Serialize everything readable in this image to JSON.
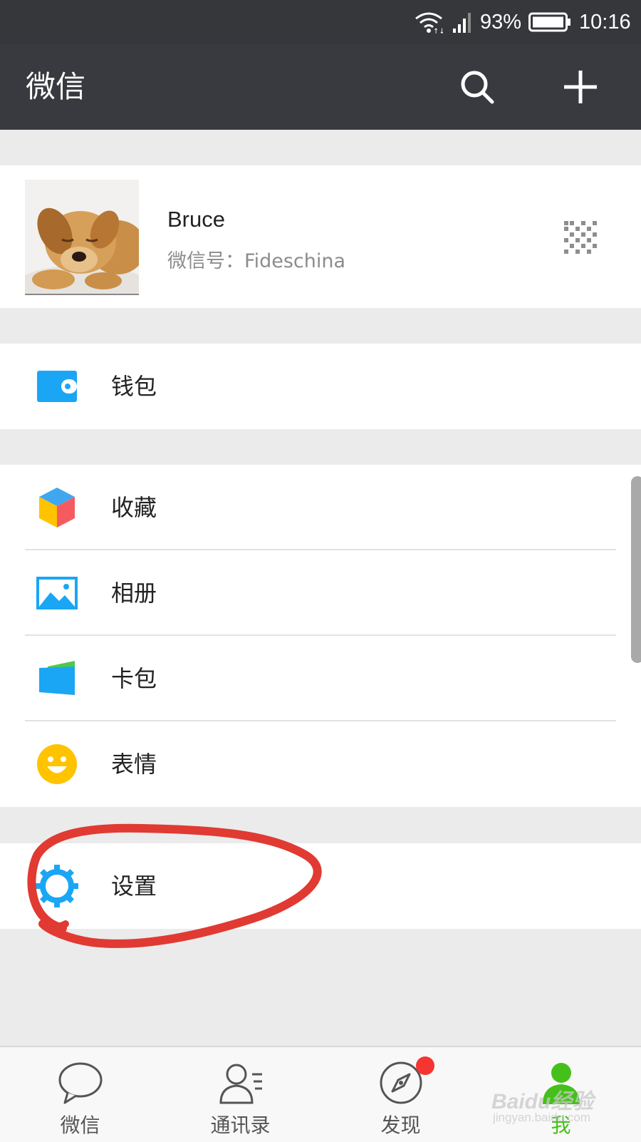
{
  "status_bar": {
    "battery_percent": "93%",
    "time": "10:16",
    "icons": [
      "wifi-icon",
      "signal-icon",
      "battery-icon"
    ]
  },
  "title_bar": {
    "title": "微信",
    "icons": [
      "search-icon",
      "plus-icon"
    ]
  },
  "profile": {
    "name": "Bruce",
    "wechat_id": "微信号：Fideschina",
    "avatar_desc": "puppy-avatar",
    "qr_icon": "qr-code-icon"
  },
  "menu": {
    "wallet": {
      "label": "钱包",
      "icon": "wallet-icon",
      "color": "#1aa6f5"
    },
    "favorites": {
      "label": "收藏",
      "icon": "cube-icon"
    },
    "album": {
      "label": "相册",
      "icon": "photo-icon",
      "color": "#1aa6f5"
    },
    "card_pack": {
      "label": "卡包",
      "icon": "card-icon",
      "color": "#1aa6f5"
    },
    "stickers": {
      "label": "表情",
      "icon": "smiley-icon",
      "color": "#ffc300"
    },
    "settings": {
      "label": "设置",
      "icon": "gear-icon",
      "color": "#1aa6f5"
    }
  },
  "tabs": [
    {
      "label": "微信",
      "icon": "chat-bubble-icon",
      "active": false
    },
    {
      "label": "通讯录",
      "icon": "contacts-icon",
      "active": false
    },
    {
      "label": "发现",
      "icon": "compass-icon",
      "active": false,
      "badge": true
    },
    {
      "label": "我",
      "icon": "person-icon",
      "active": true
    }
  ],
  "watermark": {
    "text": "Baidu经验",
    "sub": "jingyan.baidu.com"
  },
  "colors": {
    "accent_green": "#45c01a",
    "header_bg": "#393a3f",
    "annotation_red": "#e03a33"
  }
}
